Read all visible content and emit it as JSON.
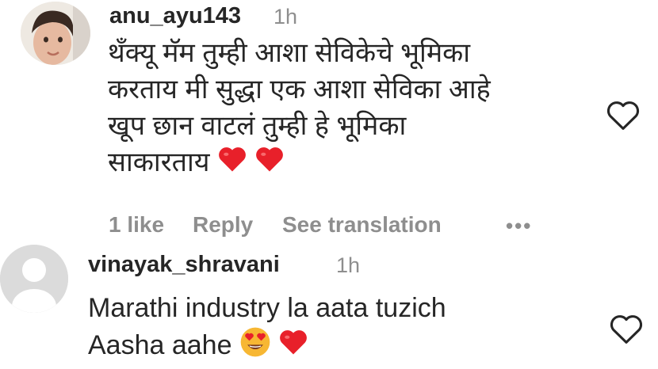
{
  "comments": [
    {
      "username": "anu_ayu143",
      "time": "1h",
      "lines": [
        "थँक्यू मॅम तुम्ही आशा सेविकेचे भूमिका",
        "करताय मी सुद्धा एक आशा सेविका आहे",
        "खूप छान वाटलं तुम्ही हे भूमिका",
        "साकारताय"
      ],
      "emojis": [
        "red-heart",
        "red-heart"
      ],
      "likes_label": "1 like",
      "reply_label": "Reply",
      "translate_label": "See translation",
      "more_label": "•••"
    },
    {
      "username": "vinayak_shravani",
      "time": "1h",
      "lines": [
        "Marathi industry la aata tuzich",
        "Aasha aahe"
      ],
      "emojis": [
        "heart-eyes-face",
        "red-heart"
      ]
    }
  ],
  "colors": {
    "heart": "#e8202a",
    "muted": "#8e8e8e",
    "text": "#262626"
  }
}
